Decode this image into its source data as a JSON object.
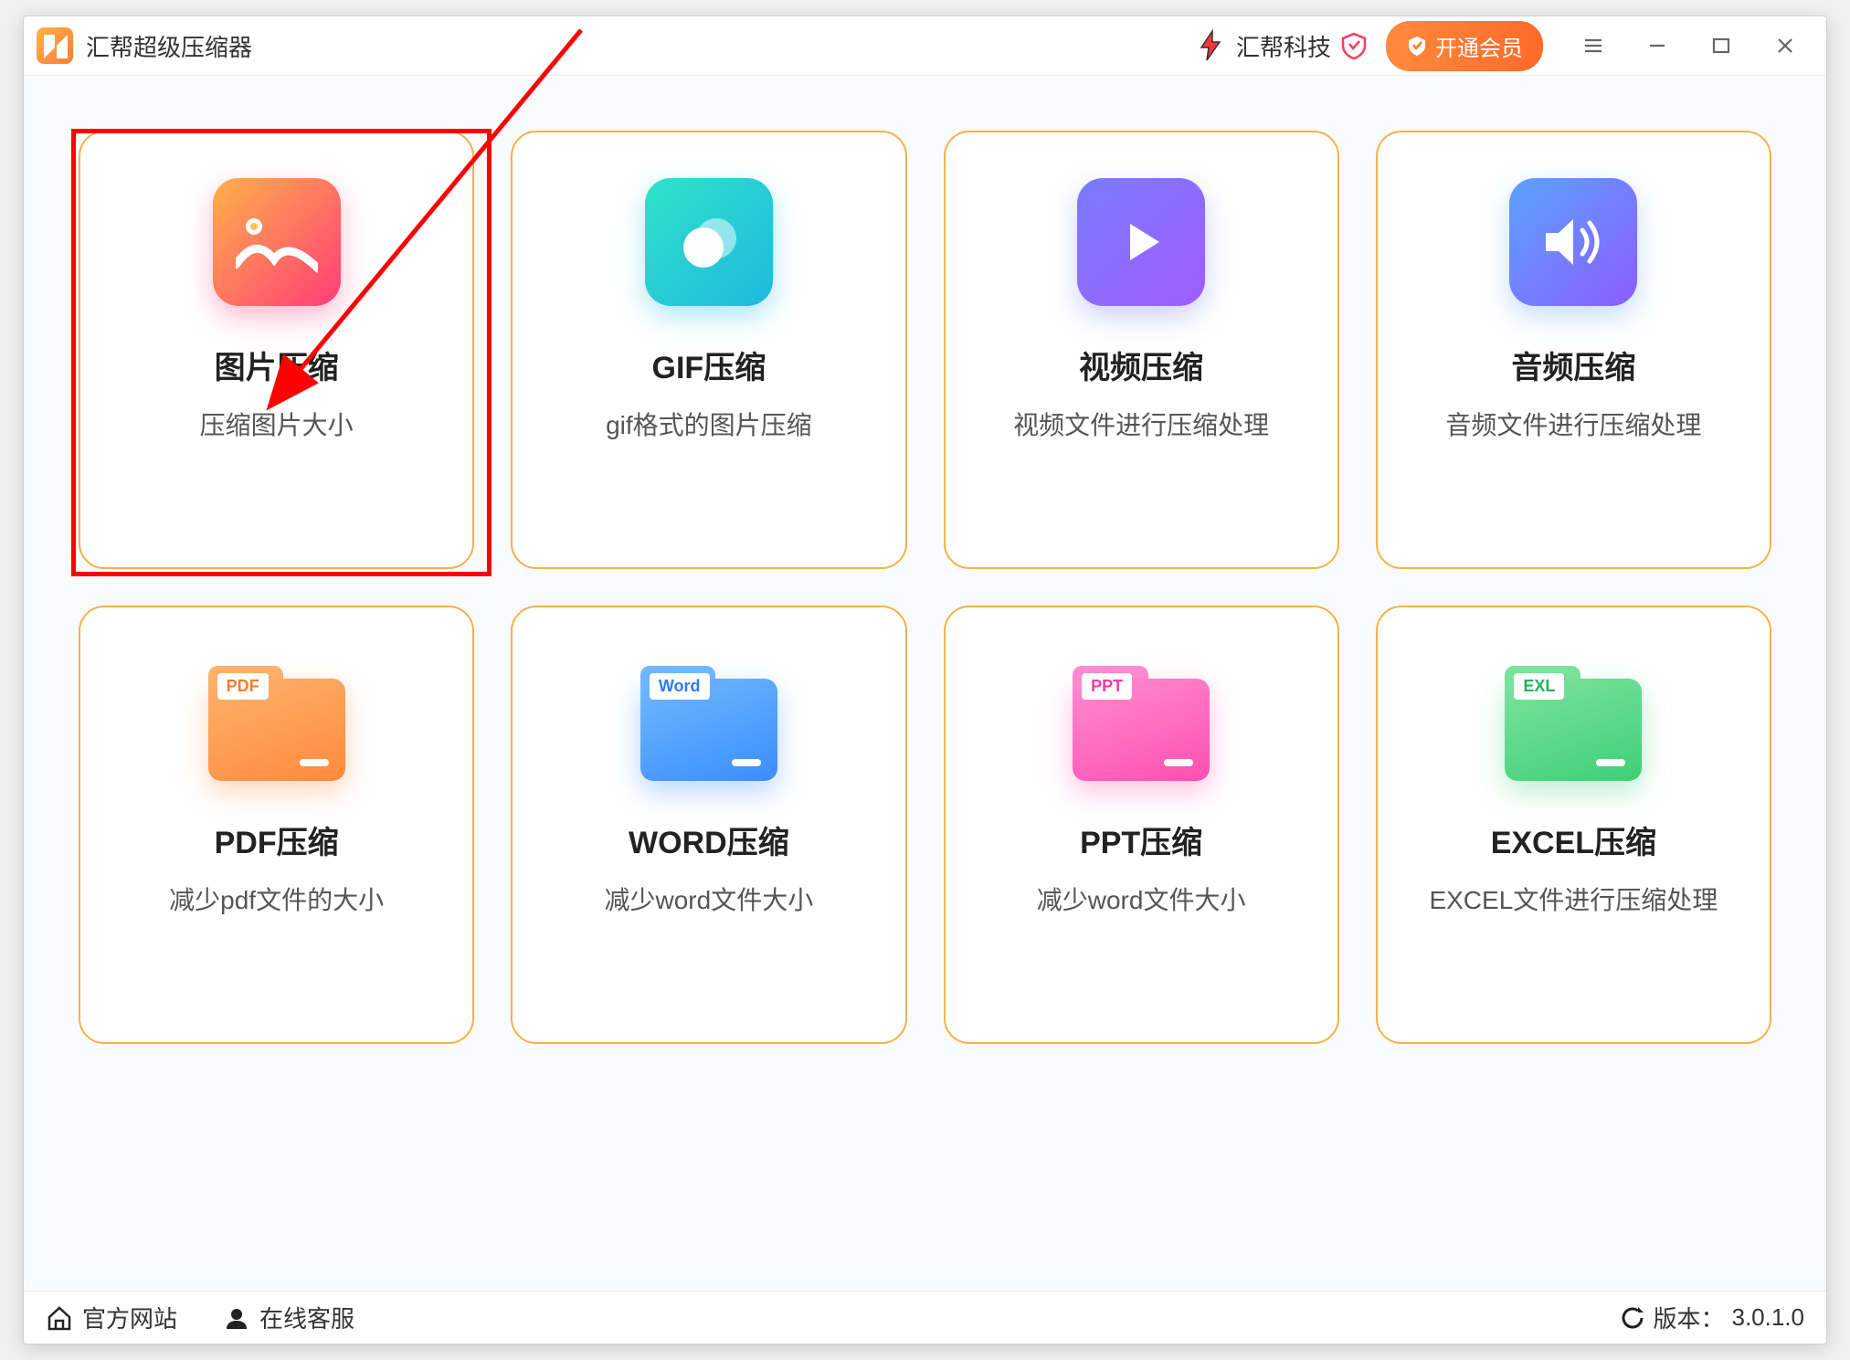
{
  "app": {
    "title": "汇帮超级压缩器"
  },
  "header": {
    "brand_text": "汇帮科技",
    "vip_button": "开通会员"
  },
  "cards": [
    {
      "title": "图片压缩",
      "desc": "压缩图片大小",
      "icon": "image"
    },
    {
      "title": "GIF压缩",
      "desc": "gif格式的图片压缩",
      "icon": "gif"
    },
    {
      "title": "视频压缩",
      "desc": "视频文件进行压缩处理",
      "icon": "video"
    },
    {
      "title": "音频压缩",
      "desc": "音频文件进行压缩处理",
      "icon": "audio"
    },
    {
      "title": "PDF压缩",
      "desc": "减少pdf文件的大小",
      "icon": "pdf",
      "folder_label": "PDF"
    },
    {
      "title": "WORD压缩",
      "desc": "减少word文件大小",
      "icon": "word",
      "folder_label": "Word"
    },
    {
      "title": "PPT压缩",
      "desc": "减少word文件大小",
      "icon": "ppt",
      "folder_label": "PPT"
    },
    {
      "title": "EXCEL压缩",
      "desc": "EXCEL文件进行压缩处理",
      "icon": "exl",
      "folder_label": "EXL"
    }
  ],
  "footer": {
    "website": "官方网站",
    "support": "在线客服",
    "version_label": "版本：",
    "version_value": "3.0.1.0"
  }
}
